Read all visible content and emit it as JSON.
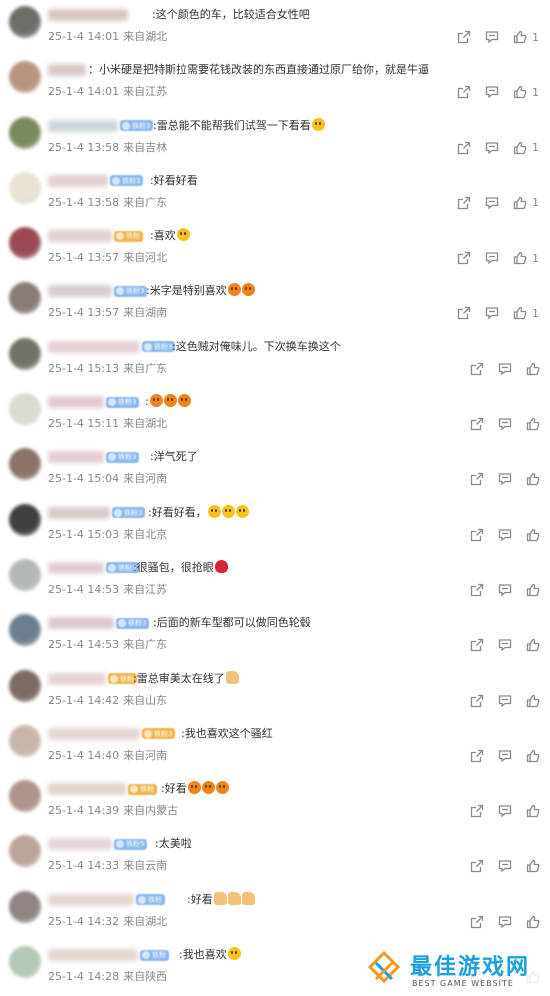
{
  "comments": [
    {
      "text": ":这个颜色的车，比较适合女性吧",
      "date": "25-1-4 14:01",
      "location": "来自湖北",
      "likes": "1",
      "emoji": [],
      "avatar": "#6a6f68",
      "name_color": "#d9c7c3",
      "name_w": 80,
      "badge": "",
      "badge_color": "#8ab8ef",
      "text_x": 152
    },
    {
      "text": "：小米硬是把特斯拉需要花钱改装的东西直接通过原厂给你，就是牛逼",
      "date": "25-1-4 14:01",
      "location": "来自江苏",
      "likes": "1",
      "emoji": [],
      "avatar": "#b8957e",
      "name_color": "#d9c9c6",
      "name_w": 38,
      "badge": "",
      "badge_color": "#8ab8ef",
      "text_x": 88
    },
    {
      "text": ":雷总能不能帮我们试驾一下看看",
      "date": "25-1-4 13:58",
      "location": "来自吉林",
      "likes": "1",
      "emoji": [
        "y"
      ],
      "avatar": "#7a8a5c",
      "name_color": "#cfd6db",
      "name_w": 70,
      "badge": "铁粉3",
      "badge_color": "#8ab8ef",
      "text_x": 153
    },
    {
      "text": ":好看好看",
      "date": "25-1-4 13:58",
      "location": "来自广东",
      "likes": "1",
      "emoji": [],
      "avatar": "#e8e3d2",
      "name_color": "#e3cfcf",
      "name_w": 60,
      "badge": "铁粉3",
      "badge_color": "#8ab8ef",
      "text_x": 150
    },
    {
      "text": ":喜欢",
      "date": "25-1-4 13:57",
      "location": "来自河北",
      "likes": "1",
      "emoji": [
        "y"
      ],
      "avatar": "#9b4a55",
      "name_color": "#e1cfcf",
      "name_w": 64,
      "badge": "铁粉",
      "badge_color": "#f0b54a",
      "text_x": 150
    },
    {
      "text": ":米字是特别喜欢",
      "date": "25-1-4 13:57",
      "location": "来自湖南",
      "likes": "1",
      "emoji": [
        "r",
        "r"
      ],
      "avatar": "#8b7b75",
      "name_color": "#d8cdcf",
      "name_w": 64,
      "badge": "铁粉3",
      "badge_color": "#8ab8ef",
      "text_x": 146
    },
    {
      "text": ":这色贼对俺味儿。下次换车换这个",
      "date": "25-1-4 15:13",
      "location": "来自广东",
      "likes": "",
      "emoji": [],
      "avatar": "#6f7566",
      "name_color": "#e8cfd3",
      "name_w": 92,
      "badge": "铁粉3",
      "badge_color": "#8ab8ef",
      "text_x": 172
    },
    {
      "text": ":",
      "date": "25-1-4 15:11",
      "location": "来自湖北",
      "likes": "",
      "emoji": [
        "r",
        "r",
        "r"
      ],
      "avatar": "#d9dcd2",
      "name_color": "#e3c9cd",
      "name_w": 56,
      "badge": "铁粉3",
      "badge_color": "#8ab8ef",
      "text_x": 145
    },
    {
      "text": ":洋气死了",
      "date": "25-1-4 15:04",
      "location": "来自河南",
      "likes": "",
      "emoji": [],
      "avatar": "#8c7268",
      "name_color": "#e6cdd1",
      "name_w": 56,
      "badge": "铁粉3",
      "badge_color": "#8ab8ef",
      "text_x": 150
    },
    {
      "text": ":好看好看，",
      "date": "25-1-4 15:03",
      "location": "来自北京",
      "likes": "",
      "emoji": [
        "y",
        "y",
        "y"
      ],
      "avatar": "#3f3f3f",
      "name_color": "#dcc9c9",
      "name_w": 62,
      "badge": "铁粉3",
      "badge_color": "#8ab8ef",
      "text_x": 148
    },
    {
      "text": ":很骚包，很抢眼",
      "date": "25-1-4 14:53",
      "location": "来自江苏",
      "likes": "",
      "emoji": [
        "f"
      ],
      "avatar": "#b3b8b8",
      "name_color": "#e3cfd2",
      "name_w": 56,
      "badge": "铁粉3",
      "badge_color": "#8ab8ef",
      "text_x": 133
    },
    {
      "text": ":后面的新车型都可以做同色轮毂",
      "date": "25-1-4 14:53",
      "location": "来自广东",
      "likes": "",
      "emoji": [],
      "avatar": "#6d7f8f",
      "name_color": "#ddc9cb",
      "name_w": 66,
      "badge": "铁粉3",
      "badge_color": "#8ab8ef",
      "text_x": 153
    },
    {
      "text": ":雷总审美太在线了",
      "date": "25-1-4 14:42",
      "location": "来自山东",
      "likes": "",
      "emoji": [
        "t"
      ],
      "avatar": "#7d6a62",
      "name_color": "#e6d3d3",
      "name_w": 58,
      "badge": "铁粉",
      "badge_color": "#f0b54a",
      "text_x": 133
    },
    {
      "text": ":我也喜欢这个骚红",
      "date": "25-1-4 14:40",
      "location": "来自河南",
      "likes": "",
      "emoji": [],
      "avatar": "#c9b6aa",
      "name_color": "#e6d6d6",
      "name_w": 92,
      "badge": "铁粉3",
      "badge_color": "#f0b54a",
      "text_x": 181
    },
    {
      "text": ":好看",
      "date": "25-1-4 14:39",
      "location": "来自内蒙古",
      "likes": "",
      "emoji": [
        "r",
        "r",
        "r"
      ],
      "avatar": "#b0938a",
      "name_color": "#e3d2cc",
      "name_w": 78,
      "badge": "铁粉",
      "badge_color": "#f0b54a",
      "text_x": 161
    },
    {
      "text": ":太美啦",
      "date": "25-1-4 14:33",
      "location": "来自云南",
      "likes": "",
      "emoji": [],
      "avatar": "#bba49a",
      "name_color": "#e6d4d6",
      "name_w": 64,
      "badge": "铁粉5",
      "badge_color": "#8ab8ef",
      "text_x": 155
    },
    {
      "text": ":好看",
      "date": "25-1-4 14:32",
      "location": "来自湖北",
      "likes": "",
      "emoji": [
        "t",
        "t",
        "t"
      ],
      "avatar": "#8f8582",
      "name_color": "#e6d8d0",
      "name_w": 86,
      "badge": "铁粉",
      "badge_color": "#8ab8ef",
      "text_x": 187
    },
    {
      "text": ":我也喜欢",
      "date": "25-1-4 14:28",
      "location": "来自陕西",
      "likes": "",
      "emoji": [
        "y"
      ],
      "avatar": "#b2c9b5",
      "name_color": "#e6d6d0",
      "name_w": 90,
      "badge": "铁粉",
      "badge_color": "#8ab8ef",
      "text_x": 179
    }
  ],
  "watermark": {
    "title": "最佳游戏网",
    "subtitle": "BEST GAME WEBSITE"
  },
  "colors": {
    "meta": "#888888",
    "icon": "#8a8a8a",
    "watermark": "#1aa0e0"
  }
}
